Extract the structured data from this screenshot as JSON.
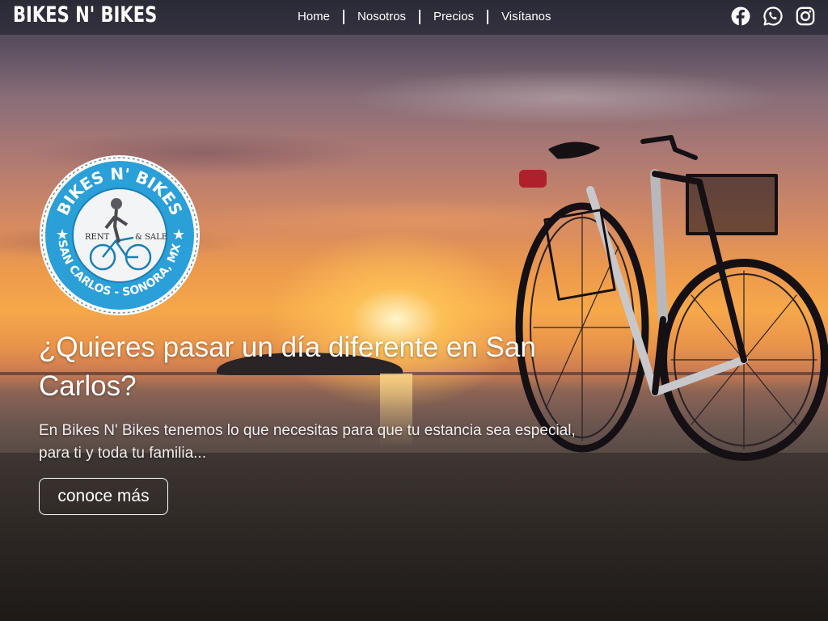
{
  "brand": "BIKES N' BIKES",
  "nav": {
    "links": [
      "Home",
      "Nosotros",
      "Precios",
      "Visítanos"
    ]
  },
  "social": [
    "facebook-icon",
    "whatsapp-icon",
    "instagram-icon"
  ],
  "logo": {
    "top_text": "BIKES N' BIKES",
    "left_text": "RENT",
    "right_text": "& SALE",
    "bottom_text": "SAN CARLOS - SONORA, MX."
  },
  "hero": {
    "headline": "¿Quieres pasar un día diferente en San Carlos?",
    "subtext": "En Bikes N' Bikes tenemos lo que necesitas para que tu estancia sea especial, para ti y toda tu familia...",
    "cta": "conoce más"
  },
  "colors": {
    "logo_blue": "#2a9fd8",
    "nav_bg": "#1e1e28",
    "text": "#ffffff"
  }
}
